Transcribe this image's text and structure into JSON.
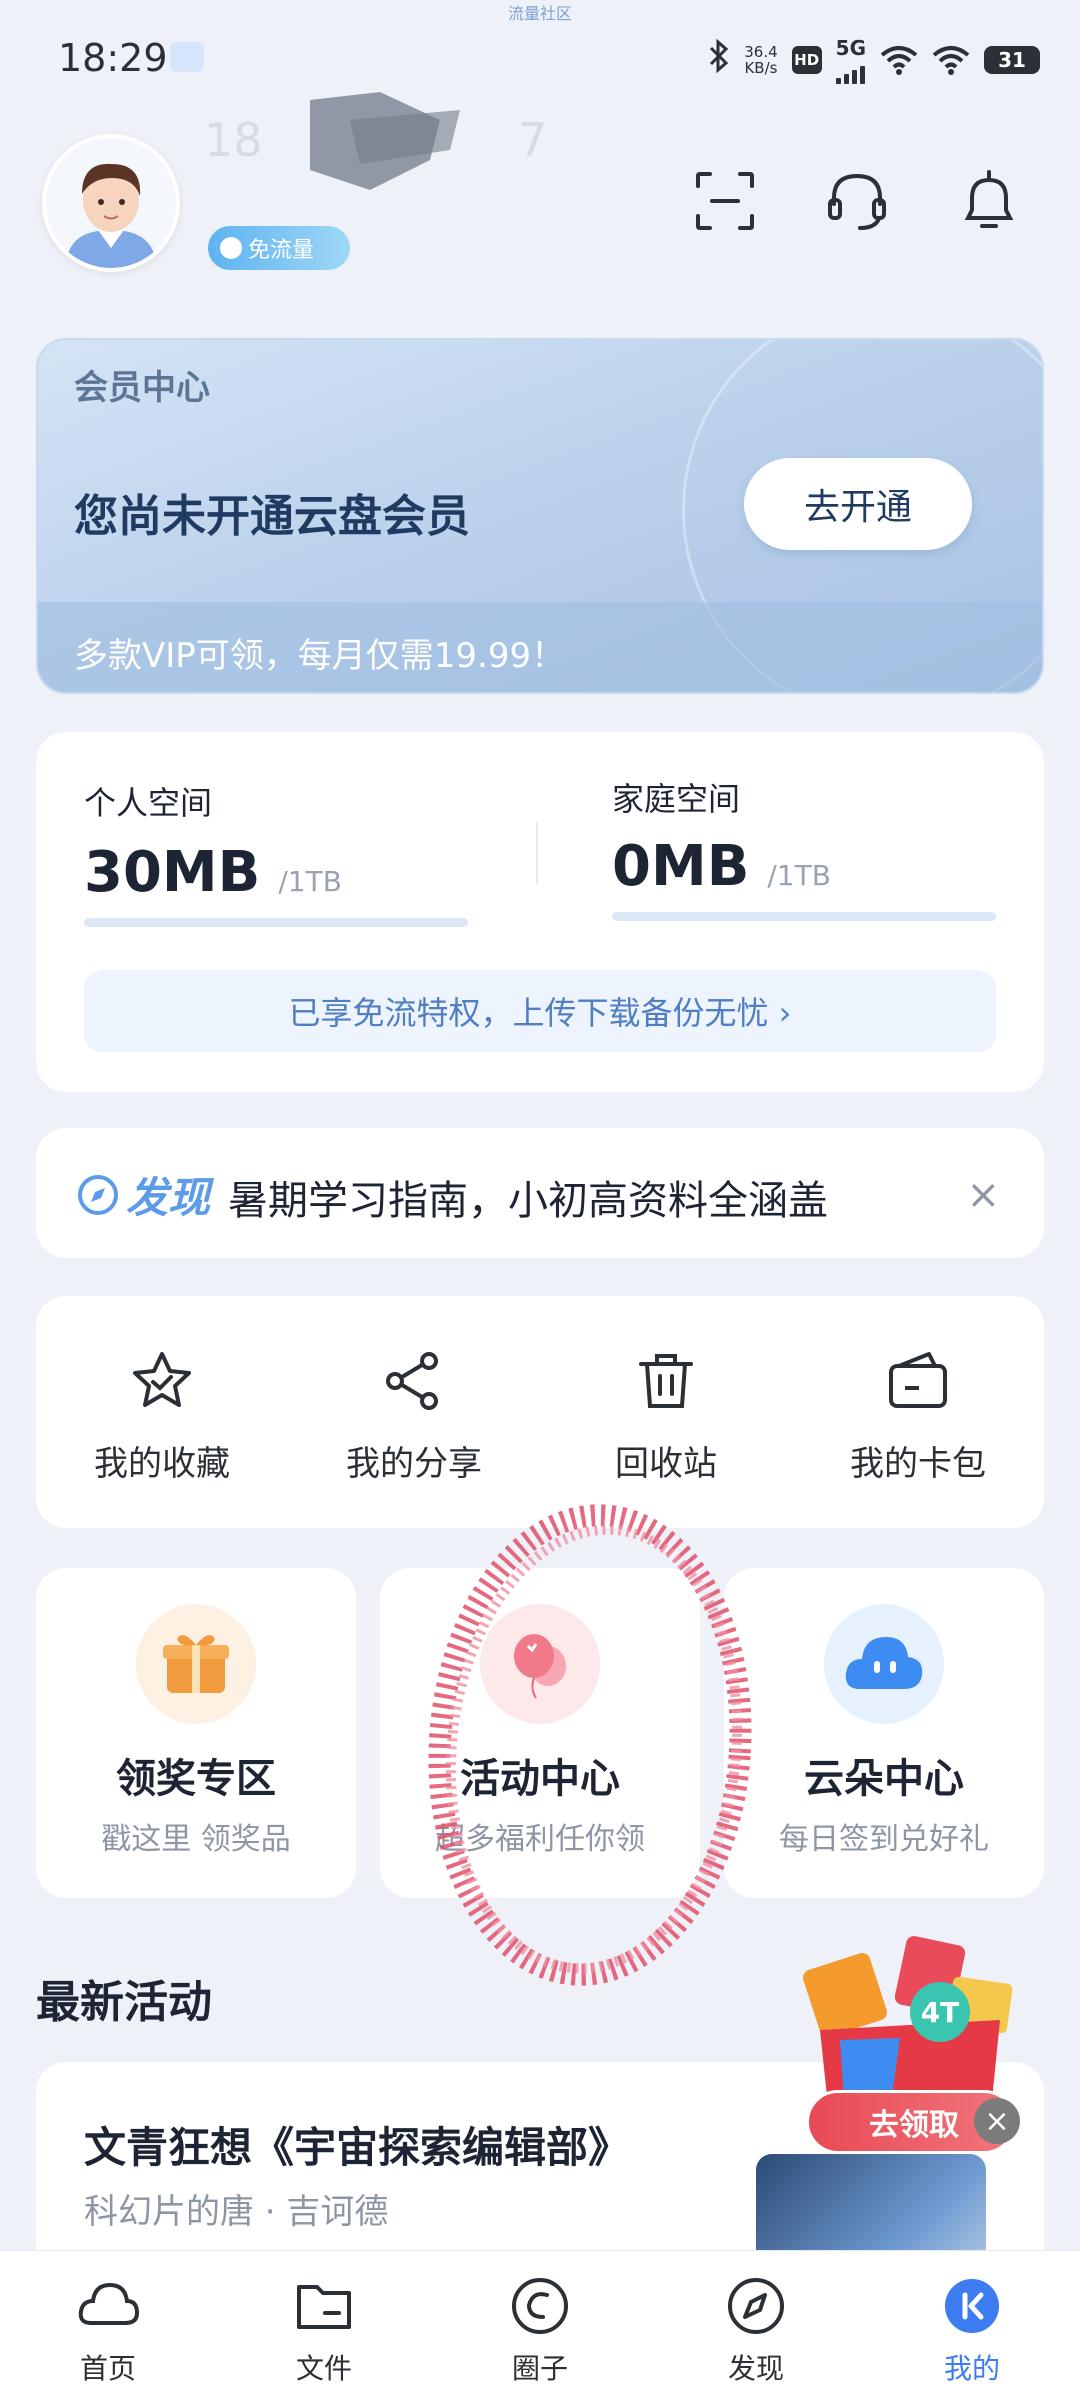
{
  "status_bar": {
    "time": "18:29",
    "top_label": "流量社区",
    "speed_value": "36.4",
    "speed_unit": "KB/s",
    "hd": "HD",
    "network": "5G",
    "battery": "31"
  },
  "header": {
    "phone_masked": "18",
    "badge": "免流量"
  },
  "vip": {
    "title": "会员中心",
    "main": "您尚未开通云盘会员",
    "button": "去开通",
    "sub": "多款VIP可领，每月仅需19.99！"
  },
  "storage": {
    "personal_label": "个人空间",
    "personal_value": "30MB",
    "personal_total": "/1TB",
    "family_label": "家庭空间",
    "family_value": "0MB",
    "family_total": "/1TB",
    "banner": "已享免流特权，上传下载备份无忧 ›"
  },
  "discover": {
    "label": "发现",
    "text": "暑期学习指南，小初高资料全涵盖",
    "close": "×"
  },
  "tools": [
    {
      "label": "我的收藏",
      "icon": "star-icon"
    },
    {
      "label": "我的分享",
      "icon": "share-icon"
    },
    {
      "label": "回收站",
      "icon": "trash-icon"
    },
    {
      "label": "我的卡包",
      "icon": "wallet-icon"
    }
  ],
  "features": [
    {
      "title": "领奖专区",
      "sub": "戳这里  领奖品",
      "icon": "gift-icon"
    },
    {
      "title": "活动中心",
      "sub": "超多福利任你领",
      "icon": "balloon-icon"
    },
    {
      "title": "云朵中心",
      "sub": "每日签到兑好礼",
      "icon": "cloud-icon"
    }
  ],
  "latest": {
    "section_title": "最新活动",
    "title": "文青狂想《宇宙探索编辑部》",
    "sub": "科幻片的唐 · 吉诃德"
  },
  "promo": {
    "button": "去领取",
    "close": "×",
    "tag": "4T"
  },
  "nav": [
    {
      "label": "首页",
      "icon": "cloud-home-icon"
    },
    {
      "label": "文件",
      "icon": "folder-icon"
    },
    {
      "label": "圈子",
      "icon": "circle-icon"
    },
    {
      "label": "发现",
      "icon": "compass-icon"
    },
    {
      "label": "我的",
      "icon": "profile-icon",
      "active": true
    }
  ],
  "colors": {
    "accent": "#3d7cf0",
    "background": "#eef2f8",
    "discover": "#5b9be8",
    "promo_red": "#e84a55"
  }
}
